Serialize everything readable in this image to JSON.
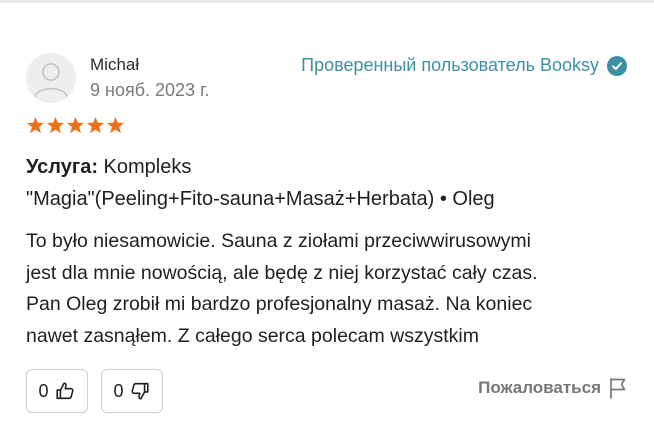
{
  "review": {
    "reviewer_name": "Michał",
    "date": "9 нояб. 2023 г.",
    "verified_label": "Проверенный пользователь Booksy",
    "rating": 5,
    "star_color": "#e8711a",
    "accent_color": "#3d8fa5",
    "service_label": "Услуга:",
    "service_line1": "Kompleks",
    "service_line2": "\"Magia\"(Peeling+Fito-sauna+Masaż+Herbata) • Oleg",
    "text_lines": [
      "To było niesamowicie. Sauna z ziołami przeciwwirusowymi",
      "jest dla mnie nowością, ale będę z niej korzystać cały czas.",
      "Pan Oleg zrobił mi bardzo profesjonalny masaż. Na koniec",
      "nawet zasnąłem. Z całego serca polecam wszystkim"
    ]
  },
  "actions": {
    "like_count": "0",
    "like_icon": "thumbs-up-icon",
    "dislike_count": "0",
    "dislike_icon": "thumbs-down-icon",
    "report_label": "Пожаловаться",
    "report_icon": "flag-icon"
  }
}
